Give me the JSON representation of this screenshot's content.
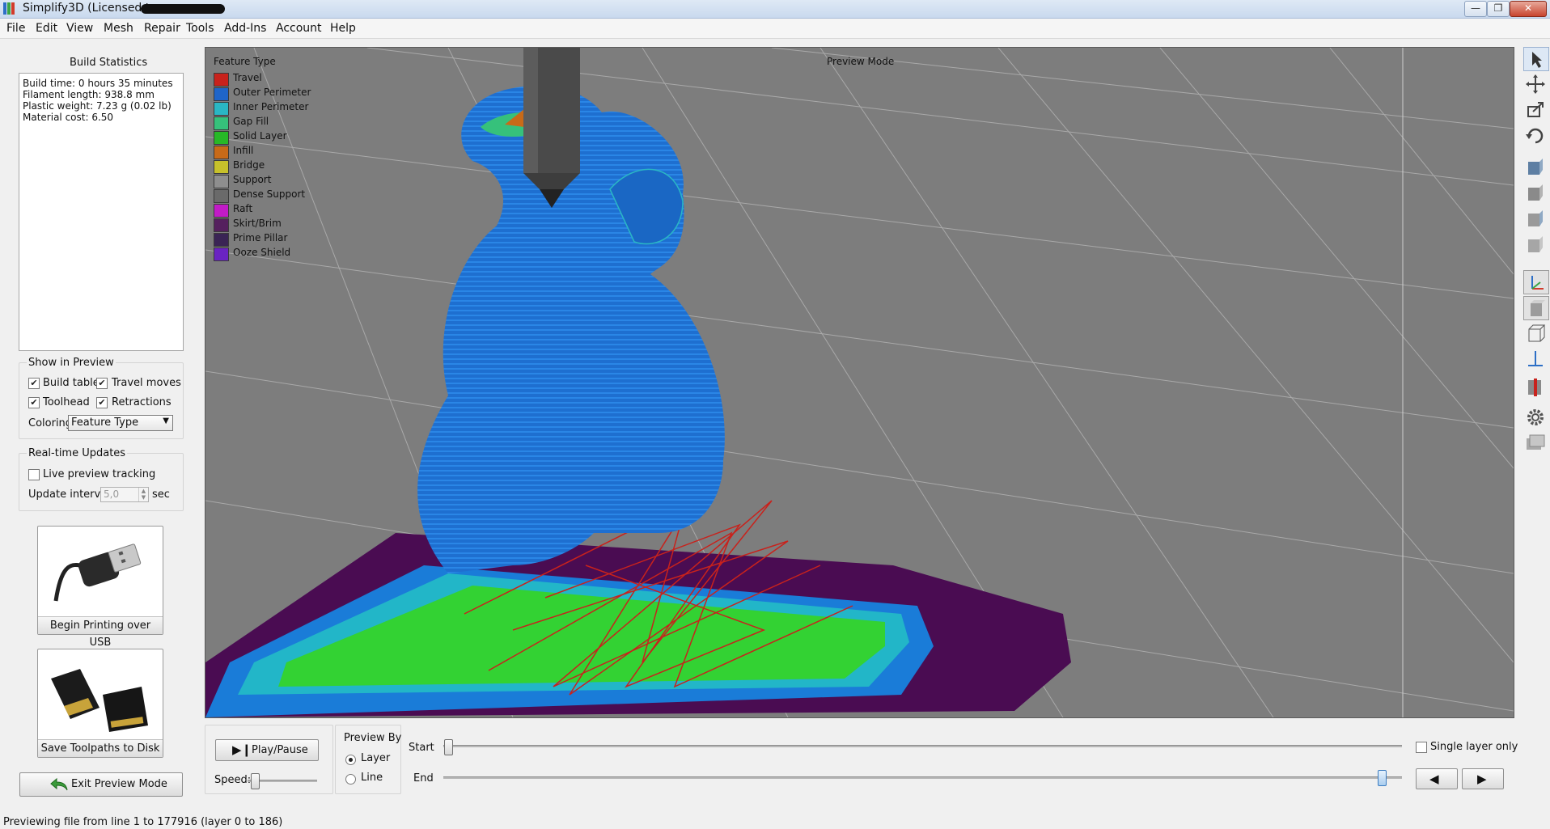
{
  "window": {
    "title": "Simplify3D (Licensed to ",
    "buttons": {
      "minimize": "—",
      "maximize": "❐",
      "close": "✕"
    }
  },
  "menu": [
    "File",
    "Edit",
    "View",
    "Mesh",
    "Repair",
    "Tools",
    "Add-Ins",
    "Account",
    "Help"
  ],
  "build_statistics": {
    "title": "Build Statistics",
    "lines": [
      "Build time: 0 hours 35 minutes",
      "Filament length: 938.8 mm",
      "Plastic weight: 7.23 g (0.02 lb)",
      "Material cost: 6.50"
    ]
  },
  "show_in_preview": {
    "title": "Show in Preview",
    "build_table": {
      "label": "Build table",
      "checked": true
    },
    "travel_moves": {
      "label": "Travel moves",
      "checked": true
    },
    "toolhead": {
      "label": "Toolhead",
      "checked": true
    },
    "retractions": {
      "label": "Retractions",
      "checked": true
    },
    "coloring_label": "Coloring",
    "coloring_value": "Feature Type"
  },
  "realtime": {
    "title": "Real-time Updates",
    "live_tracking": {
      "label": "Live preview tracking",
      "checked": false
    },
    "interval_label": "Update interval",
    "interval_value": "5,0",
    "interval_unit": "sec"
  },
  "actions": {
    "usb_label": "Begin Printing over USB",
    "disk_label": "Save Toolpaths to Disk",
    "exit_label": "Exit Preview Mode"
  },
  "viewport": {
    "mode_label": "Preview Mode",
    "legend_title": "Feature Type",
    "legend": [
      {
        "label": "Travel",
        "color": "#c8221c"
      },
      {
        "label": "Outer Perimeter",
        "color": "#1f65c9"
      },
      {
        "label": "Inner Perimeter",
        "color": "#2ab7c4"
      },
      {
        "label": "Gap Fill",
        "color": "#36c17b"
      },
      {
        "label": "Solid Layer",
        "color": "#27b827"
      },
      {
        "label": "Infill",
        "color": "#c86a18"
      },
      {
        "label": "Bridge",
        "color": "#c7c12b"
      },
      {
        "label": "Support",
        "color": "#8e8e8e"
      },
      {
        "label": "Dense Support",
        "color": "#6a6a6a"
      },
      {
        "label": "Raft",
        "color": "#c21bc7"
      },
      {
        "label": "Skirt/Brim",
        "color": "#55205e"
      },
      {
        "label": "Prime Pillar",
        "color": "#3a2455"
      },
      {
        "label": "Ooze Shield",
        "color": "#6a23c2"
      }
    ]
  },
  "toolbar_icons": [
    "select-tool-icon",
    "move-tool-icon",
    "scale-tool-icon",
    "rotate-tool-icon",
    "view-cube-front-icon",
    "view-cube-side-icon",
    "view-cube-top-icon",
    "view-cube-iso-icon",
    "axes-icon",
    "solid-view-icon",
    "wireframe-view-icon",
    "normals-icon",
    "cross-section-icon",
    "settings-gear-icon",
    "layers-icon"
  ],
  "playback": {
    "play_pause_label": "Play/Pause",
    "speed_label": "Speed:",
    "preview_by_label": "Preview By",
    "layer_label": "Layer",
    "line_label": "Line",
    "preview_by_selected": "Layer",
    "start_label": "Start",
    "end_label": "End",
    "single_layer_label": "Single layer only",
    "single_layer_checked": false,
    "start_position": 0.0,
    "end_position": 1.0,
    "prev_icon": "◀",
    "next_icon": "▶"
  },
  "status": "Previewing file from line 1 to 177916 (layer 0 to 186)"
}
